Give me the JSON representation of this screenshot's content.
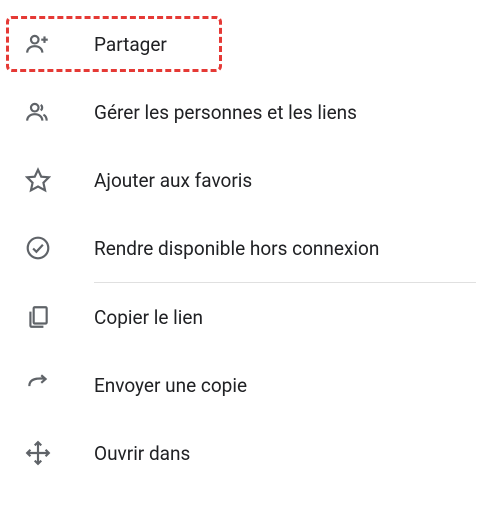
{
  "menu": {
    "items": [
      {
        "label": "Partager"
      },
      {
        "label": "Gérer les personnes et les liens"
      },
      {
        "label": "Ajouter aux favoris"
      },
      {
        "label": "Rendre disponible hors connexion"
      },
      {
        "label": "Copier le lien"
      },
      {
        "label": "Envoyer une copie"
      },
      {
        "label": "Ouvrir dans"
      }
    ]
  }
}
